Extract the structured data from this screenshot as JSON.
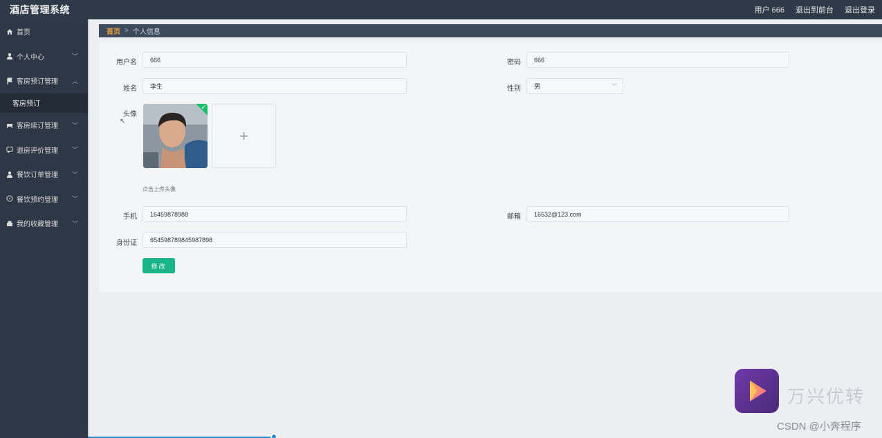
{
  "app": {
    "title": "酒店管理系统"
  },
  "topbar": {
    "user_label": "用户 666",
    "exit_front": "退出到前台",
    "logout": "退出登录"
  },
  "sidebar": {
    "items": [
      {
        "label": "首页",
        "icon": "home-icon"
      },
      {
        "label": "个人中心",
        "icon": "user-icon"
      },
      {
        "label": "客房预订管理",
        "icon": "flag-icon"
      },
      {
        "label": "客房续订管理",
        "icon": "bed-icon"
      },
      {
        "label": "退房评价管理",
        "icon": "comment-icon"
      },
      {
        "label": "餐饮订单管理",
        "icon": "user-icon"
      },
      {
        "label": "餐饮预约管理",
        "icon": "compass-icon"
      },
      {
        "label": "我的收藏管理",
        "icon": "bookmark-icon"
      }
    ],
    "submenu": {
      "label": "客房预订"
    }
  },
  "breadcrumb": {
    "home": "首页",
    "separator": ">",
    "current": "个人信息"
  },
  "form": {
    "username": {
      "label": "用户名",
      "value": "666"
    },
    "password": {
      "label": "密码",
      "value": "666"
    },
    "name": {
      "label": "姓名",
      "value": "李生"
    },
    "gender": {
      "label": "性别",
      "value": "男"
    },
    "avatar": {
      "label": "头像",
      "upload_tip": "点击上传头像",
      "plus": "+"
    },
    "phone": {
      "label": "手机",
      "value": "16459878988"
    },
    "email": {
      "label": "邮箱",
      "value": "16532@123.com"
    },
    "id_card": {
      "label": "身份证",
      "value": "654598789845987898"
    },
    "submit": "修改"
  },
  "watermark": {
    "brand": "万兴优转",
    "credit": "CSDN @小奔程序"
  },
  "colors": {
    "accent": "#19b488",
    "sidebar": "#2d3745",
    "breadcrumb_home": "#e8a23c"
  }
}
